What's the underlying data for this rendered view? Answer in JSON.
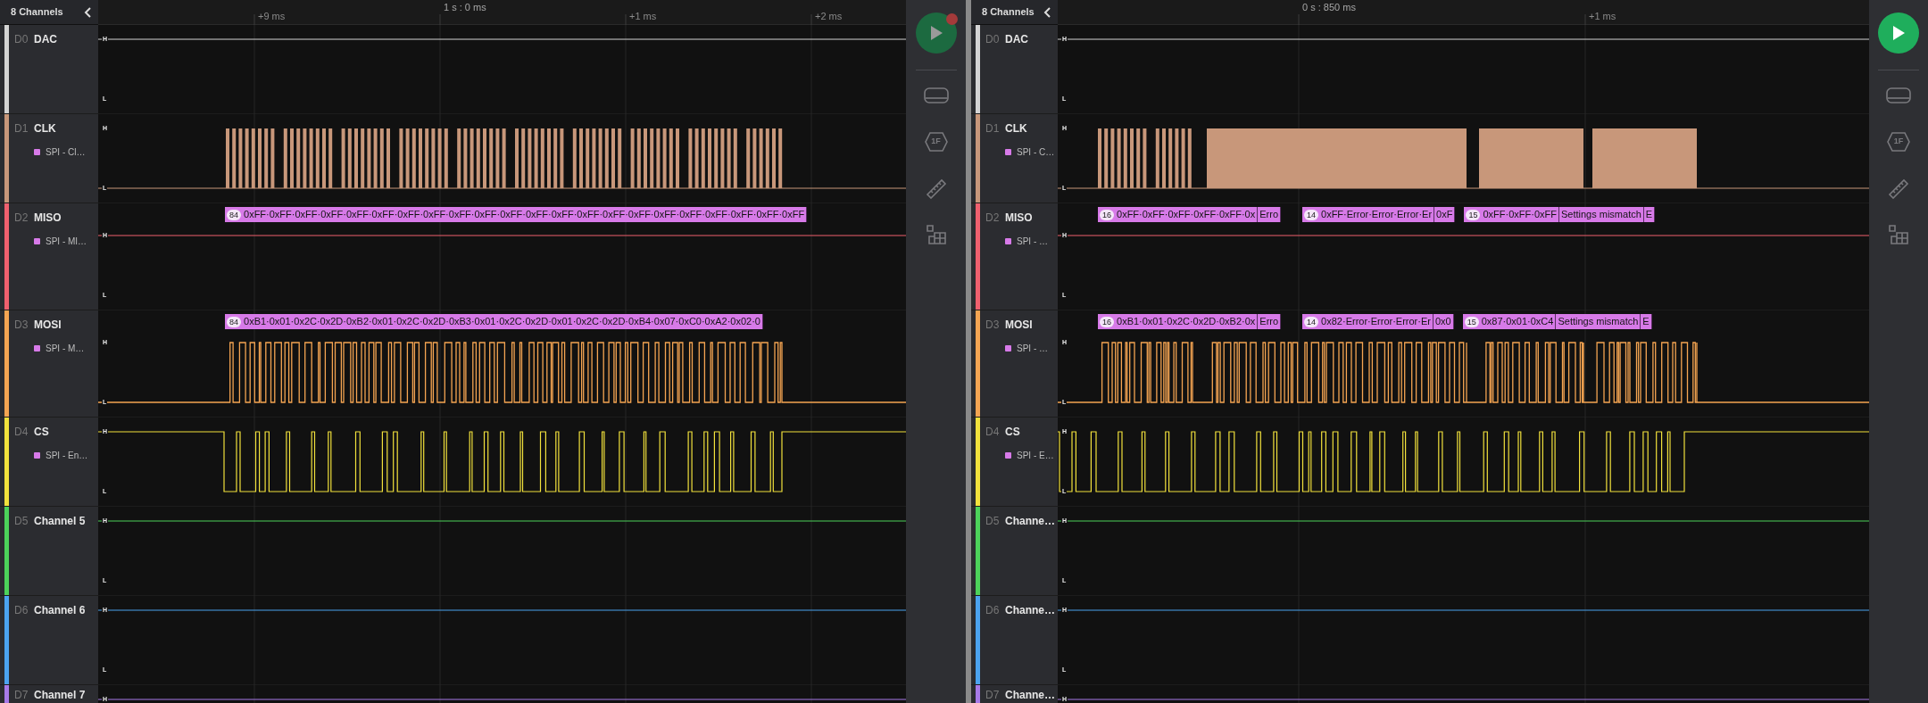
{
  "panes": [
    {
      "channel_count": "8 Channels",
      "capturing": true,
      "ruler": [
        {
          "label": "+9 ms",
          "major": false
        },
        {
          "label": "1 s : 0 ms",
          "major": true
        },
        {
          "label": "+1 ms",
          "major": false
        },
        {
          "label": "+2 ms",
          "major": false
        }
      ],
      "channels": [
        {
          "id": "D0",
          "name": "DAC",
          "color": "#d4d4d4",
          "kind": "high",
          "high_label": "H",
          "low_label": "L"
        },
        {
          "id": "D1",
          "name": "CLK",
          "color": "#c8977a",
          "kind": "clock",
          "high_label": "H",
          "low_label": "L",
          "analyzer": "SPI - Cl…"
        },
        {
          "id": "D2",
          "name": "MISO",
          "color": "#f0606e",
          "kind": "high",
          "high_label": "H",
          "low_label": "L",
          "analyzer": "SPI - MI…",
          "decode": [
            {
              "count": "84",
              "text": "0xFF·0xFF·0xFF·0xFF·0xFF·0xFF·0xFF·0xFF·0xFF·0xFF·0xFF·0xFF·0xFF·0xFF·0xFF·0xFF·0xFF·0xFF·0xFF·0xFF·0xFF·0xFF"
            }
          ]
        },
        {
          "id": "D3",
          "name": "MOSI",
          "color": "#f5a552",
          "kind": "data",
          "high_label": "H",
          "low_label": "L",
          "analyzer": "SPI - M…",
          "decode": [
            {
              "count": "84",
              "text": "0xB1·0x01·0x2C·0x2D·0xB2·0x01·0x2C·0x2D·0xB3·0x01·0x2C·0x2D·0x01·0x2C·0x2D·0xB4·0x07·0xC0·0xA2·0x02·0"
            }
          ]
        },
        {
          "id": "D4",
          "name": "CS",
          "color": "#f2e23c",
          "kind": "select",
          "high_label": "H",
          "low_label": "L",
          "analyzer": "SPI - En…"
        },
        {
          "id": "D5",
          "name": "Channel 5",
          "color": "#4cd25a",
          "kind": "high",
          "high_label": "H",
          "low_label": "L"
        },
        {
          "id": "D6",
          "name": "Channel 6",
          "color": "#4ba3f0",
          "kind": "high",
          "high_label": "H",
          "low_label": "L"
        },
        {
          "id": "D7",
          "name": "Channel 7",
          "color": "#a77ae8",
          "kind": "high",
          "high_label": "H"
        }
      ],
      "timing_label": "1F"
    },
    {
      "channel_count": "8 Channels",
      "capturing": false,
      "ruler": [
        {
          "label": "0 s : 850 ms",
          "major": true
        },
        {
          "label": "+1 ms",
          "major": false
        }
      ],
      "channels": [
        {
          "id": "D0",
          "name": "DAC",
          "color": "#d4d4d4",
          "kind": "high",
          "high_label": "H",
          "low_label": "L"
        },
        {
          "id": "D1",
          "name": "CLK",
          "color": "#c8977a",
          "kind": "clock",
          "high_label": "H",
          "low_label": "L",
          "analyzer": "SPI - C…"
        },
        {
          "id": "D2",
          "name": "MISO",
          "color": "#f0606e",
          "kind": "high",
          "high_label": "H",
          "low_label": "L",
          "analyzer": "SPI - …",
          "decode": [
            {
              "count": "16",
              "text": "0xFF·0xFF·0xFF·0xFF·0xFF·0x"
            },
            {
              "text": "Erro"
            },
            {
              "count": "14",
              "text": "0xFF·Error·Error·Error·Er"
            },
            {
              "text": "0xF"
            },
            {
              "count": "15",
              "text": "0xFF·0xFF·0xFF"
            },
            {
              "text": "Settings mismatch"
            },
            {
              "text": "E"
            }
          ]
        },
        {
          "id": "D3",
          "name": "MOSI",
          "color": "#f5a552",
          "kind": "data",
          "high_label": "H",
          "low_label": "L",
          "analyzer": "SPI - …",
          "decode": [
            {
              "count": "16",
              "text": "0xB1·0x01·0x2C·0x2D·0xB2·0x"
            },
            {
              "text": "Erro"
            },
            {
              "count": "14",
              "text": "0x82·Error·Error·Error·Er"
            },
            {
              "text": "0x0"
            },
            {
              "count": "15",
              "text": "0x87·0x01·0xC4"
            },
            {
              "text": "Settings mismatch"
            },
            {
              "text": "E"
            }
          ]
        },
        {
          "id": "D4",
          "name": "CS",
          "color": "#f2e23c",
          "kind": "select",
          "high_label": "H",
          "low_label": "L",
          "analyzer": "SPI - E…"
        },
        {
          "id": "D5",
          "name": "Channe…",
          "color": "#4cd25a",
          "kind": "high",
          "high_label": "H",
          "low_label": "L"
        },
        {
          "id": "D6",
          "name": "Channe…",
          "color": "#4ba3f0",
          "kind": "high",
          "high_label": "H",
          "low_label": "L"
        },
        {
          "id": "D7",
          "name": "Channe…",
          "color": "#a77ae8",
          "kind": "high",
          "high_label": "H"
        }
      ],
      "timing_label": "1F"
    }
  ]
}
